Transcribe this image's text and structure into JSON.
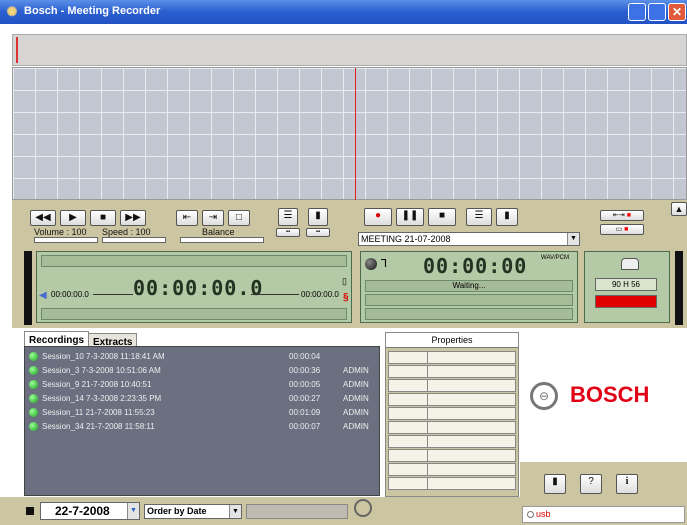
{
  "window": {
    "title": "Bosch - Meeting Recorder"
  },
  "playback": {
    "volume_label": "Volume : 100",
    "speed_label": "Speed : 100",
    "balance_label": "Balance",
    "time_main": "00:00:00.0",
    "time_start": "00:00:00.0",
    "time_end": "00:00:00.0"
  },
  "recorder": {
    "meeting_select": "MEETING 21-07-2008",
    "time": "00:00:00",
    "format": "WAV/PCM",
    "status": "Waiting...",
    "disk_remaining": "90 H 56"
  },
  "tabs": {
    "recordings": "Recordings",
    "extracts": "Extracts"
  },
  "recordings": [
    {
      "name": "Session_10  7-3-2008 11:18:41 AM",
      "duration": "00:00:04",
      "user": ""
    },
    {
      "name": "Session_3  7-3-2008 10:51:06 AM",
      "duration": "00:00:36",
      "user": "ADMIN"
    },
    {
      "name": "Session_9  21-7-2008 10:40:51",
      "duration": "00:00:05",
      "user": "ADMIN"
    },
    {
      "name": "Session_14  7-3-2008 2:23:35 PM",
      "duration": "00:00:27",
      "user": "ADMIN"
    },
    {
      "name": "Session_11  21-7-2008 11:55:23",
      "duration": "00:01:09",
      "user": "ADMIN"
    },
    {
      "name": "Session_34  21-7-2008 11:58:11",
      "duration": "00:00:07",
      "user": "ADMIN"
    }
  ],
  "properties": {
    "header": "Properties"
  },
  "filter": {
    "date": "22-7-2008",
    "order": "Order by Date"
  },
  "brand": {
    "name": "BOSCH"
  },
  "status": {
    "usb": "usb"
  },
  "colors": {
    "title_bar": "#2b5fd0",
    "panel": "#cbc5a2",
    "accent_red": "#e00000",
    "brand_red": "#e20015"
  }
}
